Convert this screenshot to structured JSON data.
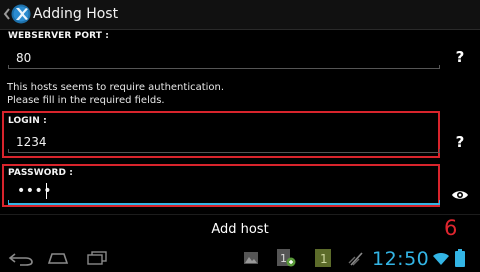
{
  "app": {
    "title": "Adding Host",
    "up_icon": "chevron-left-icon",
    "app_icon": "app-logo-icon"
  },
  "form": {
    "webserver_port": {
      "label": "WEBSERVER PORT :",
      "value": "80",
      "help": "?"
    },
    "notice": {
      "line1": "This hosts seems to require authentication.",
      "line2": "Please fill in the required fields."
    },
    "login": {
      "label": "LOGIN :",
      "value": "1234",
      "help": "?"
    },
    "password": {
      "label": "PASSWORD :",
      "masked_value": "••••",
      "toggle_icon": "eye-icon"
    }
  },
  "action": {
    "add_host_label": "Add host"
  },
  "annotation": {
    "step_number": "6",
    "color": "#e0262f"
  },
  "system_bar": {
    "clock": "12:50",
    "icons": [
      "back-icon",
      "home-icon",
      "recent-apps-icon",
      "gallery-icon",
      "notification-icon",
      "download-icon",
      "no-sim-icon",
      "wifi-icon",
      "battery-icon"
    ],
    "accent_color": "#33b5e5"
  }
}
